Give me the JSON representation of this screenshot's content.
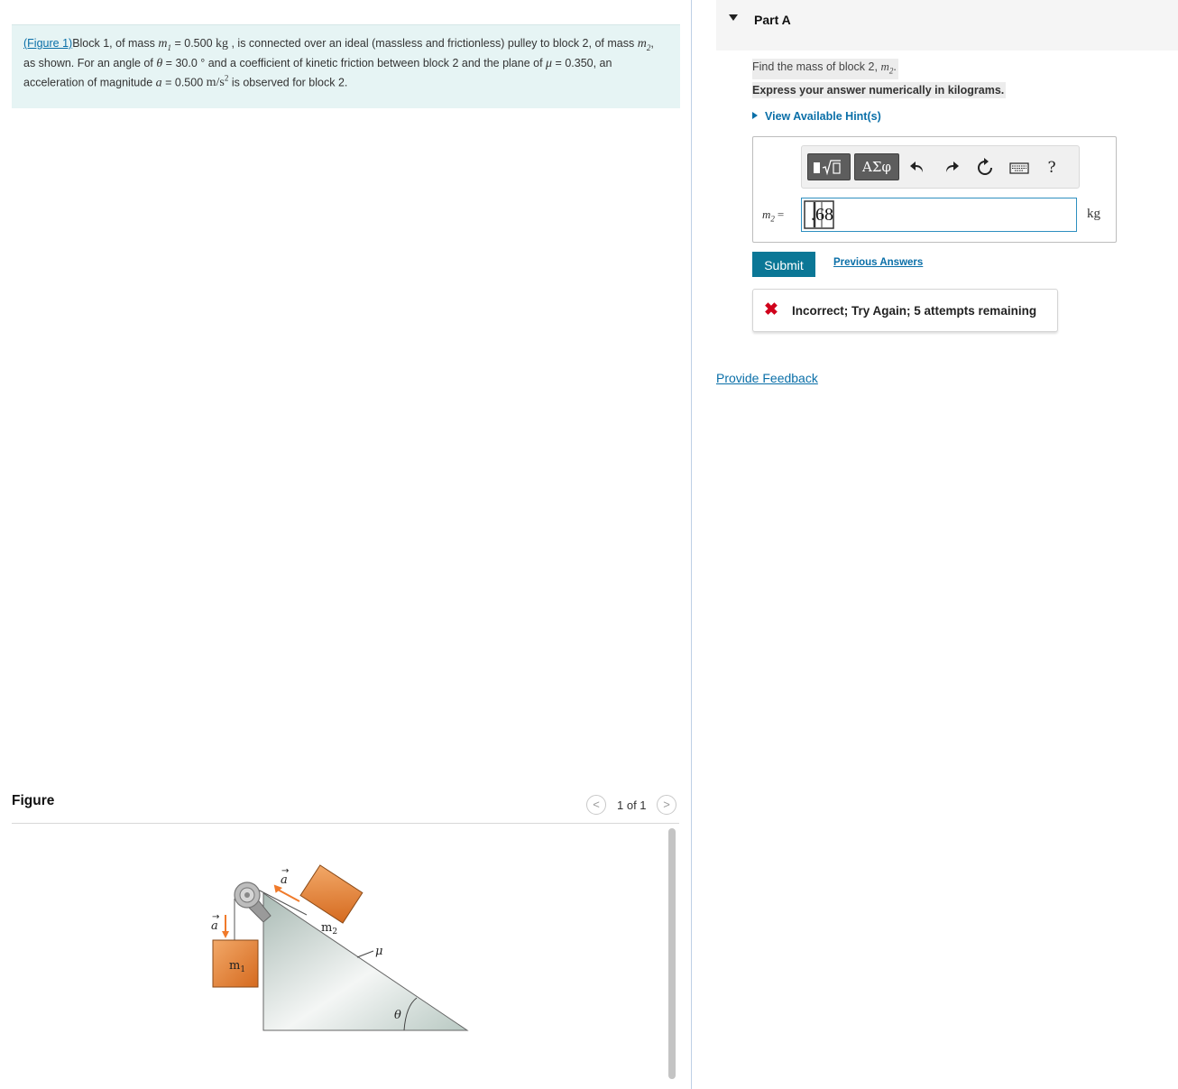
{
  "problem": {
    "figure_link": "(Figure 1)",
    "t1": "Block 1, of mass ",
    "m1_symbol": "m",
    "m1_sub": "1",
    "t2": " = 0.500 ",
    "unit_kg": "kg",
    "t3": " , is connected over an ideal (massless and frictionless) pulley to block 2, of mass ",
    "m2_symbol": "m",
    "m2_sub": "2",
    "t4": ", as shown. For an angle of ",
    "theta_symbol": "θ",
    "t5": " = 30.0 ° and a coefficient of kinetic friction between block 2 and the plane of ",
    "mu_symbol": "μ",
    "t6": " = 0.350, an acceleration of magnitude ",
    "a_symbol": "a",
    "t7": " = 0.500 ",
    "unit_accel": "m/s",
    "unit_accel_exp": "2",
    "t8": " is observed for block 2."
  },
  "figure": {
    "label": "Figure",
    "count": "1 of 1",
    "prev_glyph": "<",
    "next_glyph": ">",
    "label_m1": "m",
    "label_m1_sub": "1",
    "label_m2": "m",
    "label_m2_sub": "2",
    "label_mu": "μ",
    "label_theta": "θ",
    "label_a": "a",
    "colors": {
      "block": "#e07a2e",
      "arrow": "#f07a2a",
      "incline": "#b9c9c3"
    }
  },
  "part": {
    "title": "Part A",
    "question_prefix": "Find the mass of block 2, ",
    "question_var": "m",
    "question_sub": "2",
    "question_suffix": ".",
    "instruction": "Express your answer numerically in kilograms.",
    "hints": "View Available Hint(s)"
  },
  "toolbar": {
    "symbols_label": "ΑΣφ",
    "help_label": "?",
    "icons": [
      "templates-icon",
      "undo-icon",
      "redo-icon",
      "reset-icon",
      "keyboard-icon",
      "help-icon"
    ]
  },
  "answer": {
    "var_symbol": "m",
    "var_sub": "2",
    "equals": "=",
    "value": ".68",
    "unit": "kg"
  },
  "actions": {
    "submit": "Submit",
    "previous_answers": "Previous Answers"
  },
  "feedback": {
    "icon": "✖",
    "message": "Incorrect; Try Again; 5 attempts remaining",
    "color": "#d0021b"
  },
  "footer": {
    "provide_feedback": "Provide Feedback"
  }
}
